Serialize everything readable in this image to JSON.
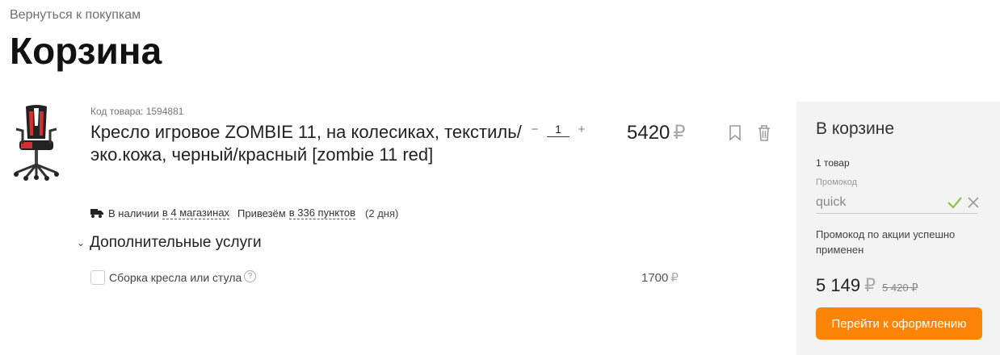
{
  "header": {
    "back_link": "Вернуться к покупкам",
    "title": "Корзина"
  },
  "currency": "₽",
  "item": {
    "image_icon": "gaming-chair-icon",
    "code": "Код товара: 1594881",
    "name": "Кресло игровое ZOMBIE 11, на колесиках, текстиль/эко.кожа, черный/красный [zombie 11 red]",
    "quantity": "1",
    "qty_minus": "−",
    "qty_plus": "+",
    "price": "5420",
    "bookmark_icon": "bookmark-icon",
    "delete_icon": "trash-icon",
    "delivery": {
      "icon": "truck-icon",
      "availability_prefix": "В наличии",
      "stores_link": "в 4 магазинах",
      "delivery_prefix": "Привезём",
      "points_link": "в 336 пунктов",
      "days": "(2 дня)"
    }
  },
  "services": {
    "toggle_icon": "chevron-down-icon",
    "title": "Дополнительные услуги",
    "items": [
      {
        "label": "Сборка кресла или стула",
        "price": "1700",
        "checked": false
      }
    ]
  },
  "summary": {
    "title": "В корзине",
    "count": "1 товар",
    "promo_label": "Промокод",
    "promo_value": "quick",
    "promo_status_icon": "check-icon",
    "promo_clear_icon": "close-icon",
    "promo_message": "Промокод по акции успешно применен",
    "total": "5 149",
    "old_total": "5 420 ₽",
    "checkout_label": "Перейти к оформлению"
  },
  "colors": {
    "accent": "#fc8507",
    "success": "#8bc34a",
    "panel_bg": "#f3f3f3"
  }
}
